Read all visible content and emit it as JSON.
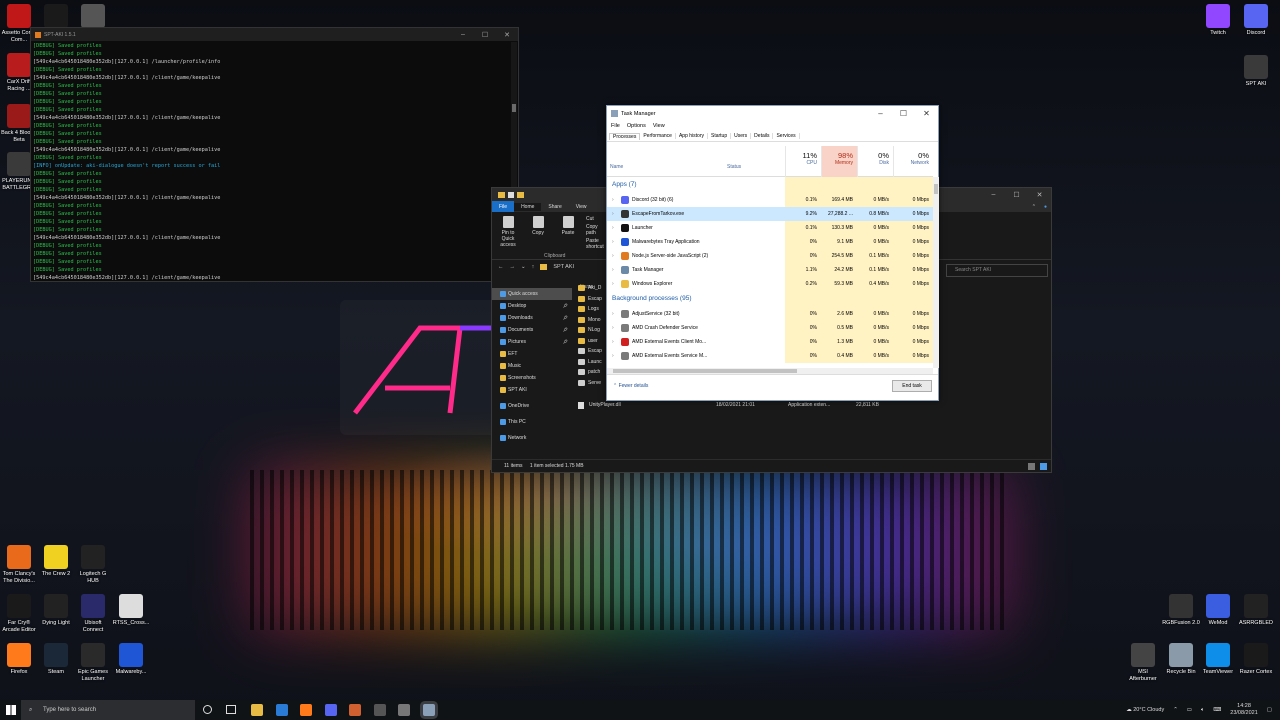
{
  "desktop": {
    "left_icons": [
      {
        "label": "Assetto Corsa Com...",
        "icon": "assetto-corsa-icon",
        "color": "#c01818"
      },
      {
        "label": "",
        "icon": "far-cry-5-icon",
        "color": "#1a1a1a"
      },
      {
        "label": "",
        "icon": "truck-icon",
        "color": "#555555"
      },
      {
        "label": "CarX Drift Racing ...",
        "icon": "carx-icon",
        "color": "#b81c1c"
      },
      {
        "label": "Back 4 Blood - Beta",
        "icon": "back4blood-icon",
        "color": "#9a1a1a"
      },
      {
        "label": "PLAYERUN... BATTLEGR...",
        "icon": "pubg-icon",
        "color": "#3a3a3a"
      }
    ],
    "bottom_left_icons": [
      {
        "label": "Tom Clancy's The Divisio...",
        "icon": "division-icon",
        "color": "#e86a1a"
      },
      {
        "label": "The Crew 2",
        "icon": "crew2-icon",
        "color": "#f0d020"
      },
      {
        "label": "Logitech G HUB",
        "icon": "logitech-icon",
        "color": "#222222"
      },
      {
        "label": "Far Cry® Arcade Editor",
        "icon": "far-cry-5-icon",
        "color": "#1a1a1a"
      },
      {
        "label": "Dying Light",
        "icon": "dying-light-icon",
        "color": "#222222"
      },
      {
        "label": "Ubisoft Connect",
        "icon": "ubisoft-icon",
        "color": "#2a2a6a"
      },
      {
        "label": "RTSS_Cross...",
        "icon": "rtss-icon",
        "color": "#dddddd"
      },
      {
        "label": "Firefox",
        "icon": "firefox-icon",
        "color": "#ff7a1a"
      },
      {
        "label": "Steam",
        "icon": "steam-icon",
        "color": "#1b2838"
      },
      {
        "label": "Epic Games Launcher",
        "icon": "epic-icon",
        "color": "#2a2a2a"
      },
      {
        "label": "Malwareby...",
        "icon": "malwarebytes-icon",
        "color": "#1e56d6"
      }
    ],
    "right_icons": [
      {
        "label": "Twitch",
        "icon": "twitch-icon",
        "color": "#9146ff"
      },
      {
        "label": "Discord",
        "icon": "discord-icon",
        "color": "#5865f2"
      },
      {
        "label": "SPT AKI",
        "icon": "spt-aki-icon",
        "color": "#3a3a3a"
      }
    ],
    "bottom_right_icons": [
      {
        "label": "RGBFusion 2.0",
        "icon": "rgbfusion-icon",
        "color": "#333333"
      },
      {
        "label": "WeMod",
        "icon": "wemod-icon",
        "color": "#3b5de0"
      },
      {
        "label": "ASRRGBLED",
        "icon": "asrock-icon",
        "color": "#222222"
      },
      {
        "label": "MSI Afterburner",
        "icon": "msi-afterburner-icon",
        "color": "#444444"
      },
      {
        "label": "Recycle Bin",
        "icon": "recycle-bin-icon",
        "color": "#8a9aa8"
      },
      {
        "label": "TeamViewer",
        "icon": "teamviewer-icon",
        "color": "#0e8ee9"
      },
      {
        "label": "Razer Cortex",
        "icon": "razer-icon",
        "color": "#1a1a1a"
      }
    ]
  },
  "console": {
    "title": "SPT-AKI 1.5.1",
    "lines": [
      {
        "text": "[DEBUG] Saved profiles",
        "kind": "g"
      },
      {
        "text": "[DEBUG] Saved profiles",
        "kind": "g"
      },
      {
        "text": "[549c4a4cb645018480e352db][127.0.0.1] /launcher/profile/info",
        "kind": "w"
      },
      {
        "text": "[DEBUG] Saved profiles",
        "kind": "g"
      },
      {
        "text": "[549c4a4cb645018480e352db][127.0.0.1] /client/game/keepalive",
        "kind": "w"
      },
      {
        "text": "[DEBUG] Saved profiles",
        "kind": "g"
      },
      {
        "text": "[DEBUG] Saved profiles",
        "kind": "g"
      },
      {
        "text": "[DEBUG] Saved profiles",
        "kind": "g"
      },
      {
        "text": "[DEBUG] Saved profiles",
        "kind": "g"
      },
      {
        "text": "[549c4a4cb645018480e352db][127.0.0.1] /client/game/keepalive",
        "kind": "w"
      },
      {
        "text": "[DEBUG] Saved profiles",
        "kind": "g"
      },
      {
        "text": "[DEBUG] Saved profiles",
        "kind": "g"
      },
      {
        "text": "[DEBUG] Saved profiles",
        "kind": "g"
      },
      {
        "text": "[549c4a4cb645018480e352db][127.0.0.1] /client/game/keepalive",
        "kind": "w"
      },
      {
        "text": "[DEBUG] Saved profiles",
        "kind": "g"
      },
      {
        "text": "[INFO] onUpdate: aki-dialogue doesn't report success or fail",
        "kind": "c"
      },
      {
        "text": "[DEBUG] Saved profiles",
        "kind": "g"
      },
      {
        "text": "[DEBUG] Saved profiles",
        "kind": "g"
      },
      {
        "text": "[DEBUG] Saved profiles",
        "kind": "g"
      },
      {
        "text": "[549c4a4cb645018480e352db][127.0.0.1] /client/game/keepalive",
        "kind": "w"
      },
      {
        "text": "[DEBUG] Saved profiles",
        "kind": "g"
      },
      {
        "text": "[DEBUG] Saved profiles",
        "kind": "g"
      },
      {
        "text": "[DEBUG] Saved profiles",
        "kind": "g"
      },
      {
        "text": "[DEBUG] Saved profiles",
        "kind": "g"
      },
      {
        "text": "[549c4a4cb645018480e352db][127.0.0.1] /client/game/keepalive",
        "kind": "w"
      },
      {
        "text": "[DEBUG] Saved profiles",
        "kind": "g"
      },
      {
        "text": "[DEBUG] Saved profiles",
        "kind": "g"
      },
      {
        "text": "[DEBUG] Saved profiles",
        "kind": "g"
      },
      {
        "text": "[DEBUG] Saved profiles",
        "kind": "g"
      },
      {
        "text": "[549c4a4cb645018480e352db][127.0.0.1] /client/game/keepalive",
        "kind": "w"
      }
    ]
  },
  "explorer": {
    "tabs": [
      "File",
      "Home",
      "Share",
      "View"
    ],
    "ribbon": {
      "pin": "Pin to Quick access",
      "copy": "Copy",
      "paste": "Paste",
      "cut": "Cut",
      "copy_path": "Copy path",
      "paste_shortcut": "Paste shortcut",
      "group": "Clipboard"
    },
    "path": "SPT AKI",
    "search_placeholder": "Search SPT AKI",
    "column_name": "Name",
    "nav": [
      {
        "label": "Quick access",
        "selected": true,
        "pinned": false
      },
      {
        "label": "Desktop",
        "selected": false,
        "pinned": true
      },
      {
        "label": "Downloads",
        "selected": false,
        "pinned": true
      },
      {
        "label": "Documents",
        "selected": false,
        "pinned": true
      },
      {
        "label": "Pictures",
        "selected": false,
        "pinned": true
      },
      {
        "label": "EFT",
        "selected": false,
        "pinned": false
      },
      {
        "label": "Music",
        "selected": false,
        "pinned": false
      },
      {
        "label": "Screenshots",
        "selected": false,
        "pinned": false
      },
      {
        "label": "SPT AKI",
        "selected": false,
        "pinned": false
      },
      {
        "label": "OneDrive",
        "selected": false,
        "pinned": false
      },
      {
        "label": "This PC",
        "selected": false,
        "pinned": false
      },
      {
        "label": "Network",
        "selected": false,
        "pinned": false
      }
    ],
    "files_partial": [
      "Aki_D",
      "Escap",
      "Logs",
      "Mono",
      "NLog",
      "user",
      "Escap",
      "Launc",
      "patch",
      "Serve"
    ],
    "unity_row": {
      "name": "UnityPlayer.dll",
      "date": "18/02/2021 21:01",
      "type": "Application exten...",
      "size": "22,811 KB"
    },
    "status": "11 items",
    "status_selected": "1 item selected  1.75 MB"
  },
  "task_manager": {
    "title": "Task Manager",
    "menu": [
      "File",
      "Options",
      "View"
    ],
    "tabs": [
      "Processes",
      "Performance",
      "App history",
      "Startup",
      "Users",
      "Details",
      "Services"
    ],
    "columns": {
      "name": "Name",
      "status": "Status",
      "cpu_pct": "11%",
      "cpu": "CPU",
      "mem_pct": "98%",
      "mem": "Memory",
      "disk_pct": "0%",
      "disk": "Disk",
      "net_pct": "0%",
      "net": "Network"
    },
    "apps_header": "Apps (7)",
    "apps": [
      {
        "name": "Discord (32 bit) (6)",
        "cpu": "0.1%",
        "mem": "169.4 MB",
        "disk": "0 MB/s",
        "net": "0 Mbps",
        "icon": "discord-icon",
        "color": "#5865f2"
      },
      {
        "name": "EscapeFromTarkov.exe",
        "cpu": "9.2%",
        "mem": "27,288.2 ...",
        "disk": "0.8 MB/s",
        "net": "0 Mbps",
        "icon": "tarkov-icon",
        "color": "#333333",
        "selected": true
      },
      {
        "name": "Launcher",
        "cpu": "0.1%",
        "mem": "130.3 MB",
        "disk": "0 MB/s",
        "net": "0 Mbps",
        "icon": "launcher-icon",
        "color": "#111111"
      },
      {
        "name": "Malwarebytes Tray Application",
        "cpu": "0%",
        "mem": "9.1 MB",
        "disk": "0 MB/s",
        "net": "0 Mbps",
        "icon": "malwarebytes-icon",
        "color": "#1e56d6"
      },
      {
        "name": "Node.js Server-side JavaScript (2)",
        "cpu": "0%",
        "mem": "254.5 MB",
        "disk": "0.1 MB/s",
        "net": "0 Mbps",
        "icon": "node-icon",
        "color": "#e07b20"
      },
      {
        "name": "Task Manager",
        "cpu": "1.1%",
        "mem": "24.2 MB",
        "disk": "0.1 MB/s",
        "net": "0 Mbps",
        "icon": "task-manager-icon",
        "color": "#6a8aa8"
      },
      {
        "name": "Windows Explorer",
        "cpu": "0.2%",
        "mem": "59.3 MB",
        "disk": "0.4 MB/s",
        "net": "0 Mbps",
        "icon": "folder-icon",
        "color": "#e8bb44"
      }
    ],
    "bg_header": "Background processes (95)",
    "bg": [
      {
        "name": "AdjustService (32 bit)",
        "cpu": "0%",
        "mem": "2.6 MB",
        "disk": "0 MB/s",
        "net": "0 Mbps",
        "icon": "service-icon",
        "color": "#7a7a7a"
      },
      {
        "name": "AMD Crash Defender Service",
        "cpu": "0%",
        "mem": "0.5 MB",
        "disk": "0 MB/s",
        "net": "0 Mbps",
        "icon": "service-icon",
        "color": "#7a7a7a"
      },
      {
        "name": "AMD External Events Client Mo...",
        "cpu": "0%",
        "mem": "1.3 MB",
        "disk": "0 MB/s",
        "net": "0 Mbps",
        "icon": "amd-icon",
        "color": "#d02020"
      },
      {
        "name": "AMD External Events Service M...",
        "cpu": "0%",
        "mem": "0.4 MB",
        "disk": "0 MB/s",
        "net": "0 Mbps",
        "icon": "service-icon",
        "color": "#7a7a7a"
      }
    ],
    "fewer_details": "Fewer details",
    "end_task": "End task"
  },
  "taskbar": {
    "search_placeholder": "Type here to search",
    "apps": [
      {
        "icon": "file-explorer-icon",
        "color": "#e8bb44"
      },
      {
        "icon": "mail-icon",
        "color": "#2a7bd6"
      },
      {
        "icon": "firefox-icon",
        "color": "#ff7a1a"
      },
      {
        "icon": "discord-icon",
        "color": "#5865f2"
      },
      {
        "icon": "game-icon",
        "color": "#d06030"
      },
      {
        "icon": "tarkov-icon",
        "color": "#555555"
      },
      {
        "icon": "truck-icon",
        "color": "#777777"
      },
      {
        "icon": "task-manager-icon",
        "color": "#8aa0b8"
      }
    ],
    "weather": "20°C  Cloudy",
    "time": "14:28",
    "date": "23/08/2021"
  }
}
